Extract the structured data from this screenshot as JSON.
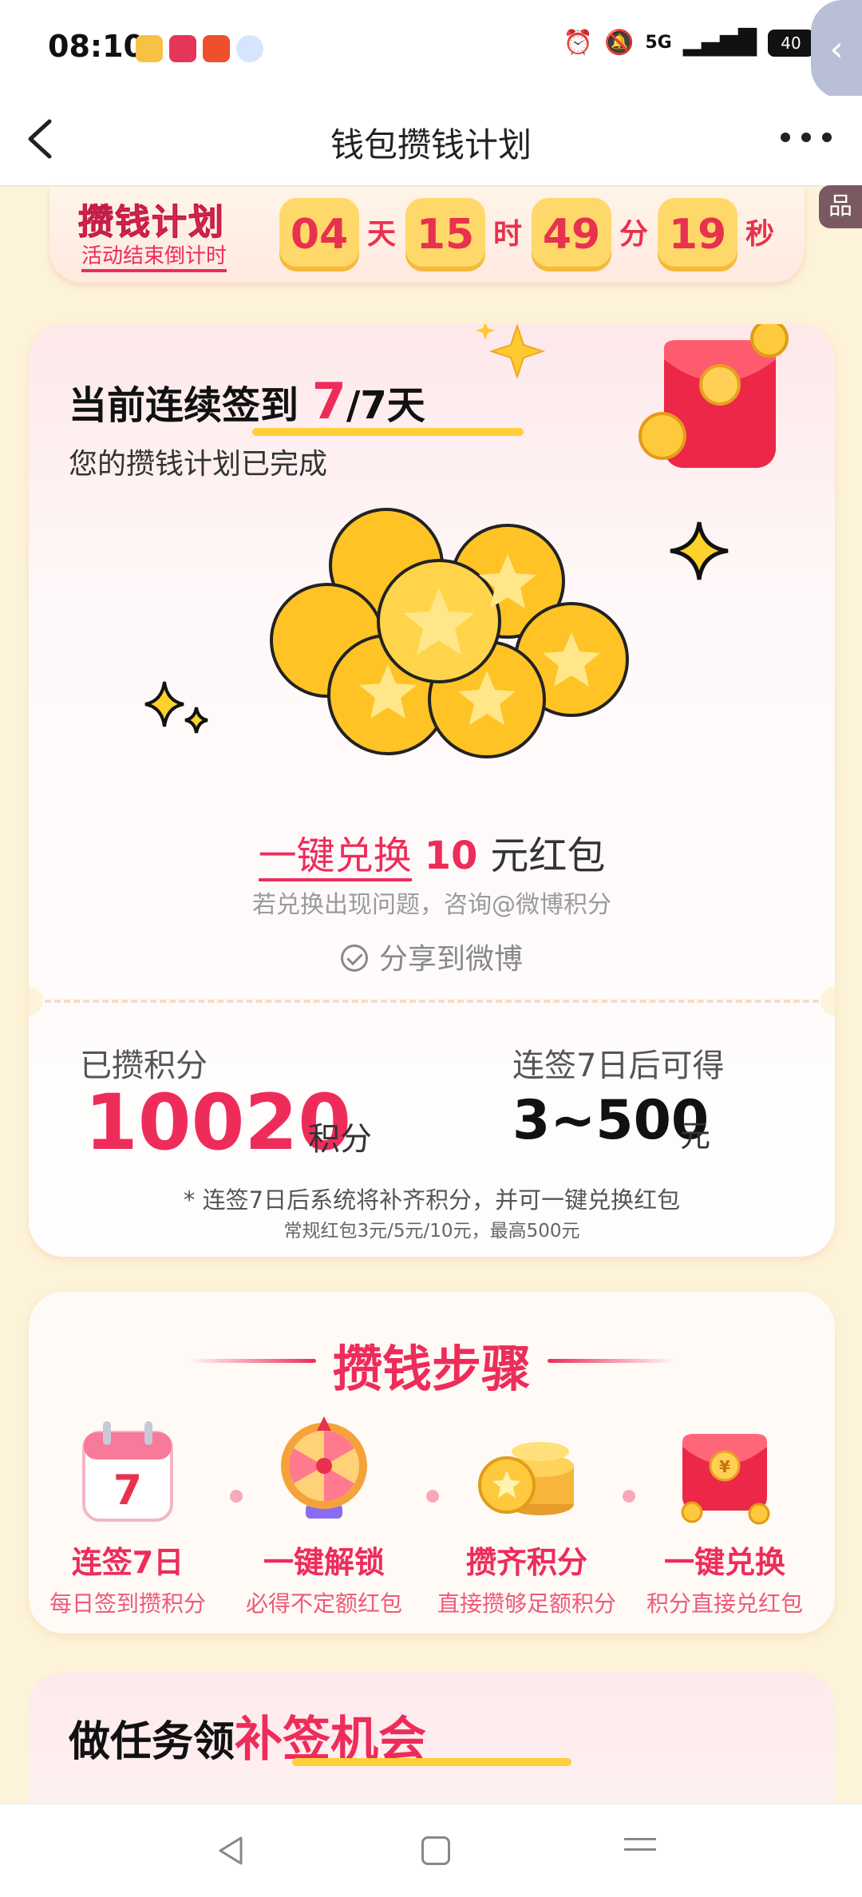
{
  "status_bar": {
    "time": "08:10",
    "network": "5G",
    "battery": "40"
  },
  "nav": {
    "title": "钱包攒钱计划"
  },
  "countdown": {
    "title": "攒钱计划",
    "subtitle": "活动结束倒计时",
    "days": "04",
    "days_unit": "天",
    "hours": "15",
    "hours_unit": "时",
    "minutes": "49",
    "minutes_unit": "分",
    "seconds": "19",
    "seconds_unit": "秒",
    "side_tag": "品"
  },
  "signin": {
    "prefix": "当前连续签到",
    "current": "7",
    "total": "/7天",
    "status": "您的攒钱计划已完成",
    "exchange_link": "一键兑换",
    "exchange_amount": "10",
    "exchange_suffix": "元红包",
    "help": "若兑换出现问题，咨询@微博积分",
    "share": "分享到微博"
  },
  "points": {
    "label": "已攒积分",
    "value": "10020",
    "unit": "积分",
    "after_label": "连签7日后可得",
    "after_value": "3~500",
    "after_unit": "元",
    "note_line1": "* 连签7日后系统将补齐积分，并可一键兑换红包",
    "note_line2": "常规红包3元/5元/10元，最高500元"
  },
  "steps": {
    "title": "攒钱步骤",
    "items": [
      {
        "name": "连签7日",
        "desc": "每日签到攒积分",
        "icon": "calendar-icon",
        "icon_text": "7"
      },
      {
        "name": "一键解锁",
        "desc": "必得不定额红包",
        "icon": "prize-wheel-icon"
      },
      {
        "name": "攒齐积分",
        "desc": "直接攒够足额积分",
        "icon": "coin-stack-icon"
      },
      {
        "name": "一键兑换",
        "desc": "积分直接兑红包",
        "icon": "red-envelope-icon"
      }
    ]
  },
  "task": {
    "prefix": "做任务领",
    "highlight": "补签机会"
  },
  "colors": {
    "accent": "#ee2c5a",
    "gold": "#ffd86a",
    "background": "#fdf3d8"
  }
}
